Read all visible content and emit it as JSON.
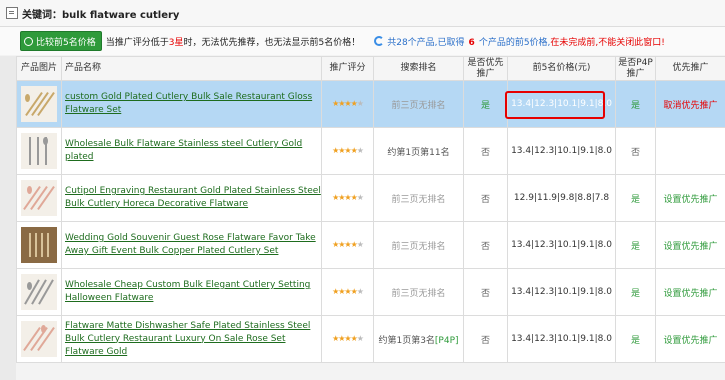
{
  "title": {
    "keyword_label": "关键词：bulk flatware cutlery"
  },
  "toolbar": {
    "compare_label": "比较前5名价格",
    "notice_pre": "当推广评分低于",
    "notice_star": "3星",
    "notice_post": "时，无法优先推荐，也无法显示前5名价格！",
    "sum_pre": "共28个产品,已取得",
    "sum_num": "6",
    "sum_mid": "个产品的前5价格,",
    "sum_warn": "在未完成前,不能关闭此窗口!"
  },
  "table": {
    "headers": [
      "产品图片",
      "产品名称",
      "推广评分",
      "搜索排名",
      "是否优先推广",
      "前5名价格(元)",
      "是否P4P推广",
      "优先推广"
    ],
    "rows": [
      {
        "thumb": "gold-cutlery",
        "name": "custom Gold Plated Cutlery Bulk Sale Restaurant Gloss Flatware Set",
        "stars": 4,
        "rank": "前三页无排名",
        "priority": "是",
        "prices": "13.4|12.3|10.1|9.1|8.0",
        "p4p": "是",
        "action": "取消优先推广"
      },
      {
        "thumb": "silver-cutlery",
        "name": "Wholesale Bulk Flatware Stainless steel Cutlery Gold plated",
        "stars": 4,
        "rank": "约第1页第11名",
        "priority": "否",
        "prices": "13.4|12.3|10.1|9.1|8.0",
        "p4p": "否",
        "action": ""
      },
      {
        "thumb": "pink-cutlery",
        "name": "Cutipol Engraving Restaurant Gold Plated Stainless Steel Bulk Cutlery Horeca Decorative Flatware",
        "stars": 4,
        "rank": "前三页无排名",
        "priority": "否",
        "prices": "12.9|11.9|9.8|8.8|7.8",
        "p4p": "是",
        "action": "设置优先推广"
      },
      {
        "thumb": "gift-box",
        "name": "Wedding Gold Souvenir Guest Rose Flatware Favor Take Away Gift Event Bulk Copper Plated Cutlery Set",
        "stars": 4,
        "rank": "前三页无排名",
        "priority": "否",
        "prices": "13.4|12.3|10.1|9.1|8.0",
        "p4p": "是",
        "action": "设置优先推广"
      },
      {
        "thumb": "silver-set",
        "name": "Wholesale Cheap Custom Bulk Elegant Cutlery Setting Halloween Flatware",
        "stars": 4,
        "rank": "前三页无排名",
        "priority": "否",
        "prices": "13.4|12.3|10.1|9.1|8.0",
        "p4p": "是",
        "action": "设置优先推广"
      },
      {
        "thumb": "rose-cutlery",
        "name": "Flatware Matte Dishwasher Safe Plated Stainless Steel Bulk Cutlery Restaurant Luxury On Sale Rose Set Flatware Gold",
        "stars": 4,
        "rank": "约第1页第3名",
        "rank_tag": "[P4P]",
        "priority": "否",
        "prices": "13.4|12.3|10.1|9.1|8.0",
        "p4p": "是",
        "action": "设置优先推广"
      }
    ]
  },
  "colors": {
    "accent_green": "#2e9a3a",
    "selected_row": "#b5d8f4",
    "warning_red": "#e60000",
    "link_green": "#1e6c1e"
  }
}
